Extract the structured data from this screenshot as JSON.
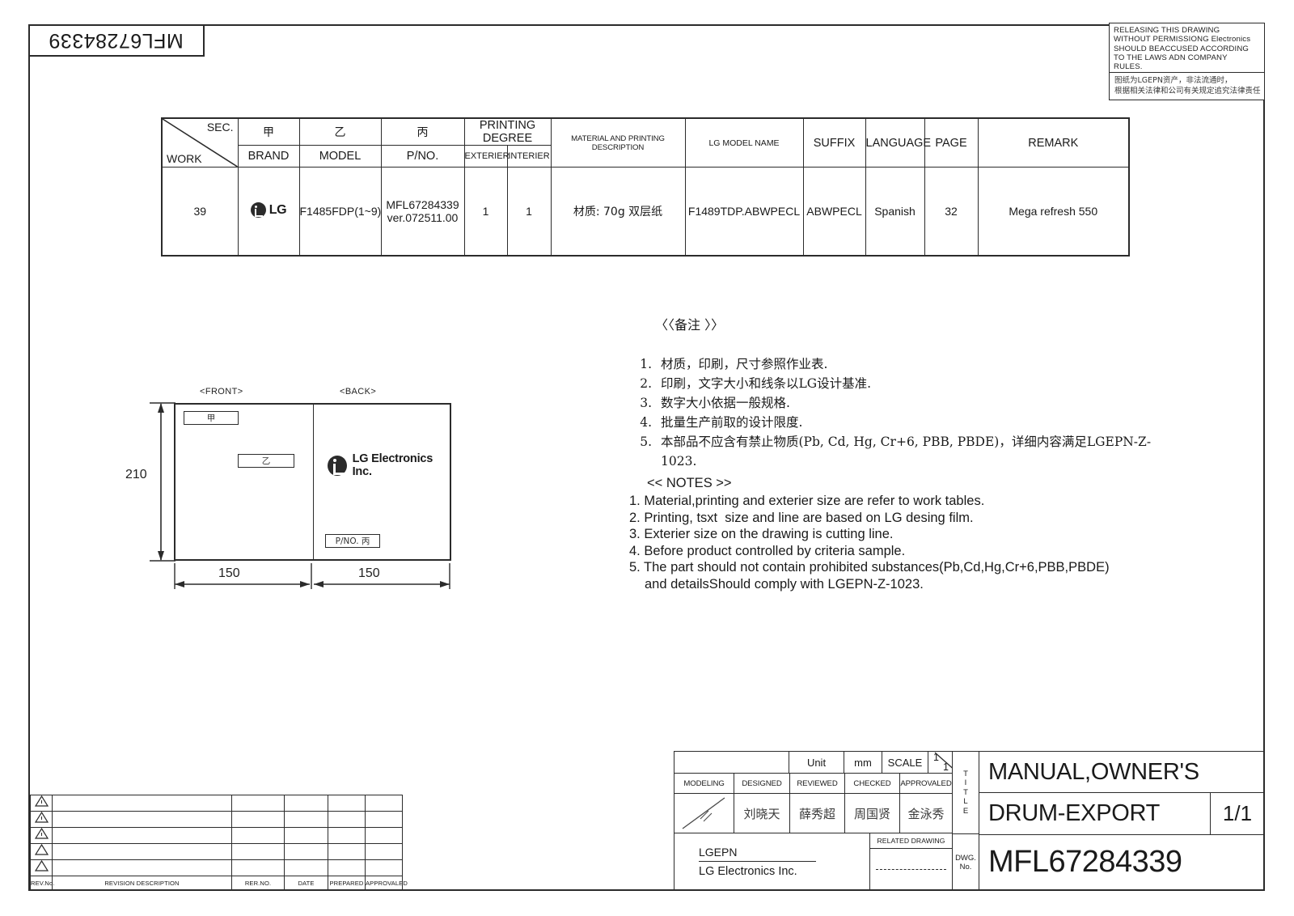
{
  "document": {
    "part_number_tab": "MFL67284339"
  },
  "notice": {
    "english_lines": [
      "RELEASING THIS DRAWING",
      "WITHOUT PERMISSIONG Electronics",
      "SHOULD BEACCUSED ACCORDING",
      "TO THE LAWS ADN COMPANY",
      "RULES."
    ],
    "chinese_lines": [
      "图纸为LGEPN资产，非法流通时，",
      "根据相关法律和公司有关规定追究法律责任"
    ]
  },
  "spec_table": {
    "corner": {
      "sec": "SEC.",
      "work": "WORK"
    },
    "headers_cn": [
      "甲",
      "乙",
      "丙"
    ],
    "headers": [
      {
        "top": "甲",
        "bottom": "BRAND"
      },
      {
        "top": "乙",
        "bottom": "MODEL"
      },
      {
        "top": "丙",
        "bottom": "P/NO."
      }
    ],
    "printing_degree": {
      "group": "PRINTING DEGREE",
      "exterier": "EXTERIER",
      "interier": "INTERIER"
    },
    "material_desc_header": "MATERIAL AND PRINTING DESCRIPTION",
    "lg_model_name_header": "LG MODEL NAME",
    "suffix_header": "SUFFIX",
    "language_header": "LANGUAGE",
    "page_header": "PAGE",
    "remark_header": "REMARK",
    "row": {
      "work": "39",
      "brand": "LG",
      "model": "F1485FDP(1~9)",
      "pno_line1": "MFL67284339",
      "pno_line2": "ver.072511.00",
      "exterier": "1",
      "interier": "1",
      "material": "材质: 70g 双层纸",
      "lg_model_name": "F1489TDP.ABWPECL",
      "suffix": "ABWPECL",
      "language": "Spanish",
      "page": "32",
      "remark": "Mega refresh 550"
    }
  },
  "artwork": {
    "front_label": "<FRONT>",
    "back_label": "<BACK>",
    "tag_jia": "甲",
    "tag_yi": "乙",
    "tag_pno": "P/NO. 丙",
    "lg_text": "LG Electronics Inc.",
    "dim_height": "210",
    "dim_width_left": "150",
    "dim_width_right": "150"
  },
  "notes_cn": {
    "heading": "〈〈备注 〉〉",
    "items": [
      "材质，印刷，尺寸参照作业表.",
      "印刷，文字大小和线条以LG设计基准.",
      "数字大小依据一般规格.",
      "批量生产前取的设计限度.",
      "本部品不应含有禁止物质(Pb, Cd, Hg, Cr+6, PBB, PBDE)，详细内容满足LGEPN-Z-1023."
    ]
  },
  "notes_en": {
    "heading": "<< NOTES >>",
    "items": [
      "1. Material,printing and exterier size are refer to work tables.",
      "2. Printing, tsxt  size and line are based on LG desing film.",
      "3. Exterier size on the drawing is cutting line.",
      "4. Before product controlled by criteria sample.",
      "5. The part should not contain prohibited substances(Pb,Cd,Hg,Cr+6,PBB,PBDE)"
    ],
    "continuation": "and detailsShould comply with LGEPN-Z-1023."
  },
  "revision_table": {
    "headers": [
      "REV.No.",
      "REVISION DESCRIPTION",
      "RER.NO.",
      "DATE",
      "PREPARED",
      "APPROVALED"
    ],
    "rows": [
      {
        "rev": "",
        "description": "",
        "rer_no": "",
        "date": "",
        "prepared": "",
        "approvaled": ""
      },
      {
        "rev": "",
        "description": "",
        "rer_no": "",
        "date": "",
        "prepared": "",
        "approvaled": ""
      },
      {
        "rev": "",
        "description": "",
        "rer_no": "",
        "date": "",
        "prepared": "",
        "approvaled": ""
      },
      {
        "rev": "",
        "description": "",
        "rer_no": "",
        "date": "",
        "prepared": "",
        "approvaled": ""
      },
      {
        "rev": "",
        "description": "",
        "rer_no": "",
        "date": "",
        "prepared": "",
        "approvaled": ""
      }
    ]
  },
  "title_block": {
    "unit_label": "Unit",
    "unit_value": "mm",
    "scale_label": "SCALE",
    "scale_numerator": "1",
    "scale_denominator": "1",
    "role_headers": {
      "modeling": "MODELING",
      "designed": "DESIGNED",
      "reviewed": "REVIEWED",
      "checked": "CHECKED",
      "approvaled": "APPROVALED"
    },
    "role_values": {
      "modeling": "",
      "designed": "刘晓天",
      "reviewed": "薛秀超",
      "checked": "周国贤",
      "approvaled": "金泳秀"
    },
    "company_code": "LGEPN",
    "company_name": "LG Electronics Inc.",
    "related_drawing_label": "RELATED DRAWING",
    "title_vertical_label": "TITLE",
    "dwg_vertical_label_line1": "DWG.",
    "dwg_vertical_label_line2": "No.",
    "title_line1": "MANUAL,OWNER'S",
    "title_line2": "DRUM-EXPORT",
    "sheet": "1/1",
    "dwg_no": "MFL67284339"
  }
}
